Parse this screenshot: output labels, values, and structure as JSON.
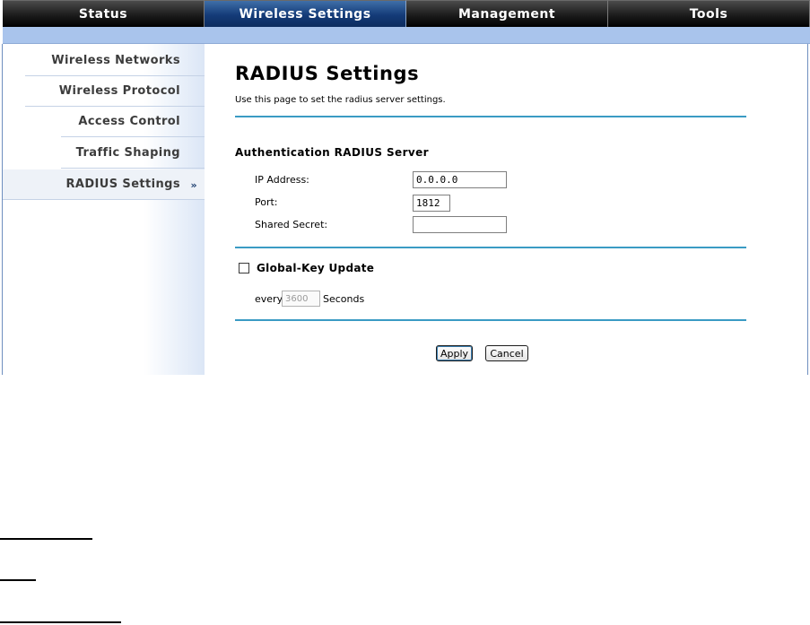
{
  "nav": {
    "tabs": [
      {
        "label": "Status"
      },
      {
        "label": "Wireless Settings"
      },
      {
        "label": "Management"
      },
      {
        "label": "Tools"
      }
    ],
    "active_tab": "Wireless Settings"
  },
  "sidebar": {
    "items": [
      {
        "label": "Wireless Networks"
      },
      {
        "label": "Wireless Protocol"
      },
      {
        "label": "Access Control"
      },
      {
        "label": "Traffic Shaping"
      },
      {
        "label": "RADIUS Settings"
      }
    ],
    "active_item": "RADIUS Settings",
    "active_arrow": "»"
  },
  "main": {
    "title": "RADIUS Settings",
    "description": "Use this page to set the radius server settings.",
    "auth_section": {
      "heading": "Authentication RADIUS Server",
      "ip_label": "IP Address:",
      "ip_value": "0.0.0.0",
      "port_label": "Port:",
      "port_value": "1812",
      "secret_label": "Shared Secret:",
      "secret_value": ""
    },
    "global_key": {
      "checkbox_label": "Global-Key Update",
      "checked": false,
      "every_label": "every",
      "interval_value": "3600",
      "seconds_label": "Seconds"
    },
    "buttons": {
      "apply": "Apply",
      "cancel": "Cancel"
    }
  },
  "colors": {
    "nav_active": "#143b78",
    "subbar": "#a9c4ec",
    "divider": "#3a9bc4"
  }
}
